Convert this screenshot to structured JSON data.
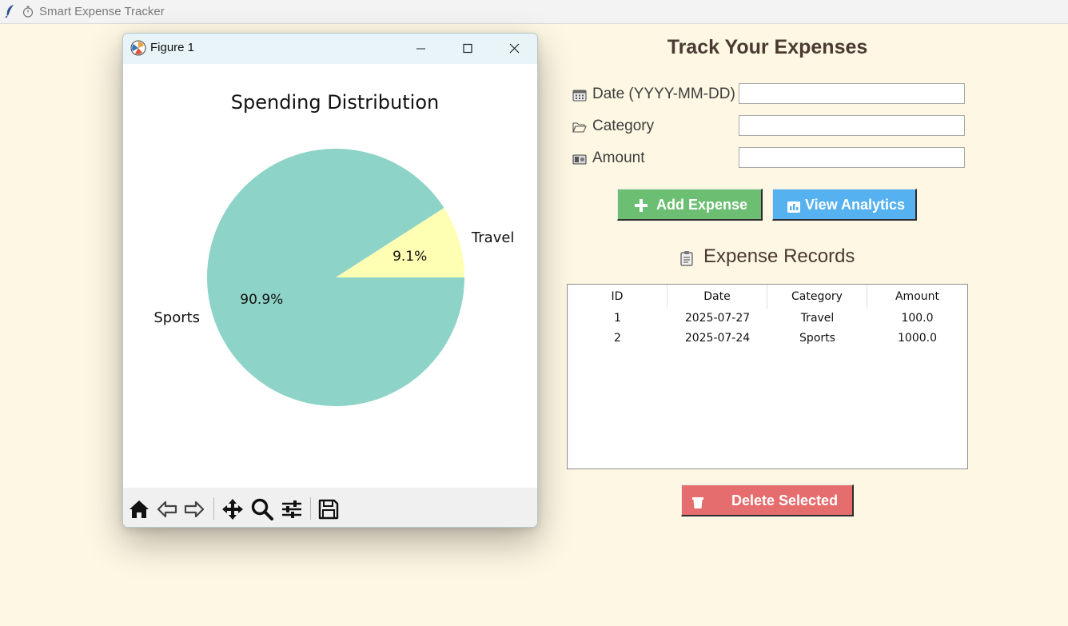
{
  "app": {
    "title": "Smart Expense Tracker"
  },
  "form": {
    "heading": "Track Your Expenses",
    "date_label": "Date (YYYY-MM-DD)",
    "category_label": "Category",
    "amount_label": "Amount",
    "date_value": "",
    "category_value": "",
    "amount_value": ""
  },
  "buttons": {
    "add_label": "Add Expense",
    "analytics_label": "View Analytics",
    "delete_label": "Delete Selected"
  },
  "records": {
    "heading": "Expense Records",
    "columns": [
      "ID",
      "Date",
      "Category",
      "Amount"
    ],
    "rows": [
      [
        "1",
        "2025-07-27",
        "Travel",
        "100.0"
      ],
      [
        "2",
        "2025-07-24",
        "Sports",
        "1000.0"
      ]
    ]
  },
  "figure": {
    "window_title": "Figure 1",
    "toolbar": [
      "home-icon",
      "back-icon",
      "forward-icon",
      "pan-icon",
      "zoom-icon",
      "configure-subplots-icon",
      "save-icon"
    ]
  },
  "chart_data": {
    "type": "pie",
    "title": "Spending Distribution",
    "labels": [
      "Travel",
      "Sports"
    ],
    "values": [
      100.0,
      1000.0
    ],
    "percent_labels": [
      "9.1%",
      "90.9%"
    ],
    "colors": [
      "#ffffb3",
      "#8dd3c7"
    ],
    "start_angle_deg": 0,
    "direction": "counterclockwise"
  },
  "colors": {
    "background": "#fef7e3",
    "add_button": "#6cbe72",
    "analytics_button": "#56b1f1",
    "delete_button": "#e56d6d",
    "heading_text": "#4a3a32"
  }
}
